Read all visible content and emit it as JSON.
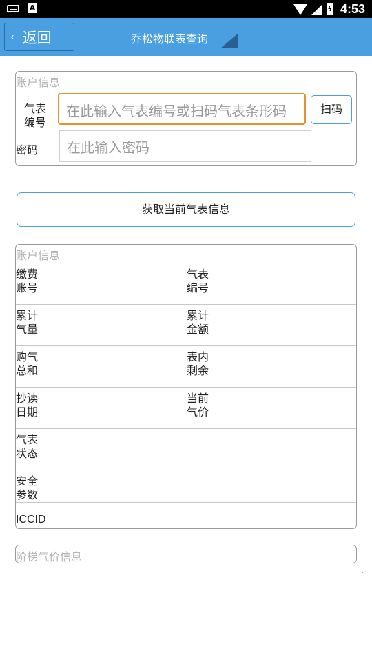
{
  "status_bar": {
    "time": "4:53",
    "battery_icon": "battery-charging-icon",
    "notification_icons": [
      "keyboard-icon",
      "a-app-icon"
    ],
    "status_icons": [
      "wifi-icon",
      "signal-icon"
    ]
  },
  "app_bar": {
    "back_chevron": "‹",
    "back_label": "返回",
    "title": "乔松物联表查询",
    "accent_color": "#4a9fe0"
  },
  "account_form": {
    "legend": "账户信息",
    "meter_label_line1": "气表",
    "meter_label_line2": "编号",
    "meter_placeholder": "在此输入气表编号或扫码气表条形码",
    "scan_label": "扫码",
    "password_label": "密码",
    "password_placeholder": "在此输入密码"
  },
  "fetch_button": "获取当前气表信息",
  "account_info": {
    "legend": "账户信息",
    "rows": [
      {
        "left1": "缴费",
        "left2": "账号",
        "right1": "气表",
        "right2": "编号"
      },
      {
        "left1": "累计",
        "left2": "气量",
        "right1": "累计",
        "right2": "金额"
      },
      {
        "left1": "购气",
        "left2": "总和",
        "right1": "表内",
        "right2": "剩余"
      },
      {
        "left1": "抄读",
        "left2": "日期",
        "right1": "当前",
        "right2": "气价"
      },
      {
        "left1": "气表",
        "left2": "状态"
      },
      {
        "left1": "安全",
        "left2": "参数"
      }
    ],
    "iccid": "ICCID"
  },
  "tier_price": {
    "legend": "阶梯气价信息"
  }
}
